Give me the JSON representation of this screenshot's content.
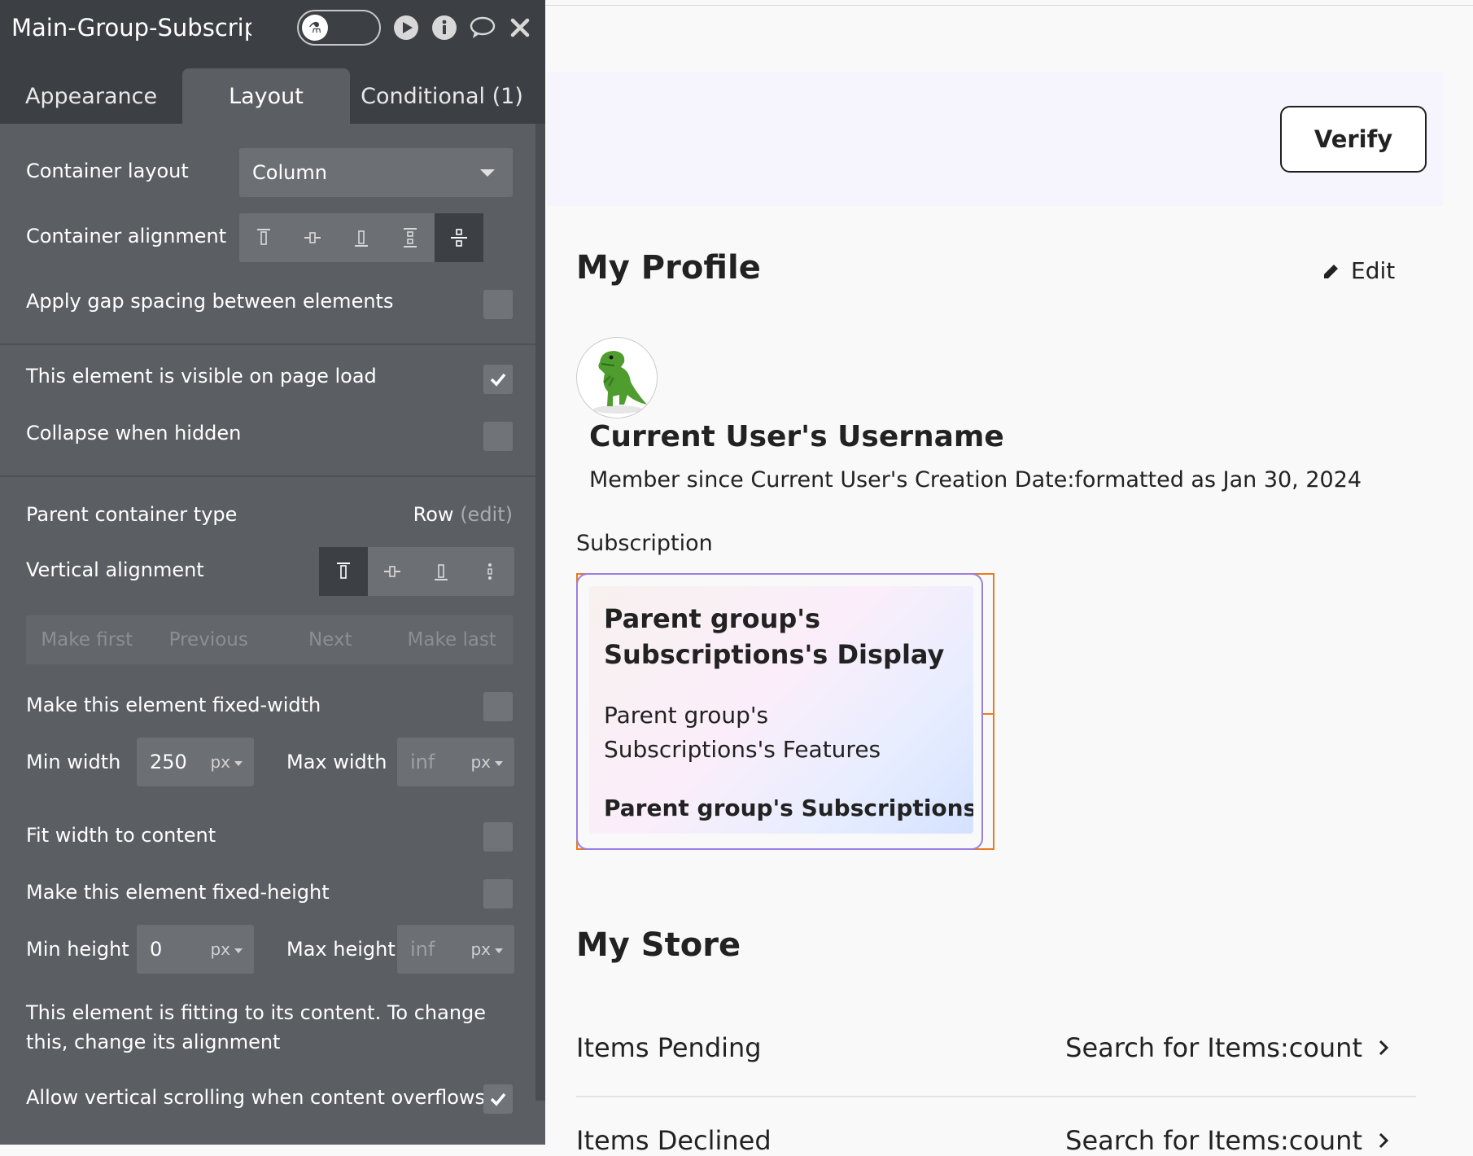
{
  "panel": {
    "title": "Main-Group-Subscription",
    "tabs": [
      "Appearance",
      "Layout",
      "Conditional (1)"
    ],
    "container_layout": {
      "label": "Container layout",
      "value": "Column"
    },
    "container_alignment": {
      "label": "Container alignment"
    },
    "gap_spacing": {
      "label": "Apply gap spacing between elements",
      "checked": false
    },
    "visible_on_load": {
      "label": "This element is visible on page load",
      "checked": true
    },
    "collapse_hidden": {
      "label": "Collapse when hidden",
      "checked": false
    },
    "parent_container": {
      "label": "Parent container type",
      "value": "Row",
      "edit": "(edit)"
    },
    "vertical_alignment": {
      "label": "Vertical alignment"
    },
    "order_buttons": [
      "Make first",
      "Previous",
      "Next",
      "Make last"
    ],
    "fixed_width": {
      "label": "Make this element fixed-width",
      "checked": false
    },
    "min_width": {
      "label": "Min width",
      "value": "250",
      "unit": "px"
    },
    "max_width": {
      "label": "Max width",
      "value": "inf",
      "unit": "px"
    },
    "fit_width": {
      "label": "Fit width to content",
      "checked": false
    },
    "fixed_height": {
      "label": "Make this element fixed-height",
      "checked": false
    },
    "min_height": {
      "label": "Min height",
      "value": "0",
      "unit": "px"
    },
    "max_height": {
      "label": "Max height",
      "value": "inf",
      "unit": "px"
    },
    "fitting_note": "This element is fitting to its content. To change this, change its alignment",
    "vertical_scroll": {
      "label": "Allow vertical scrolling when content overflows",
      "checked": true
    }
  },
  "canvas": {
    "verify_label": "Verify",
    "profile_title": "My Profile",
    "edit_label": "Edit",
    "username": "Current User's Username",
    "member_since": "Member since Current User's Creation Date:formatted as Jan 30, 2024",
    "subscription_label": "Subscription",
    "card": {
      "title": "Parent group's Subscriptions's Display",
      "features": "Parent group's Subscriptions's Features",
      "price": "Parent group's Subscriptions's Price"
    },
    "store_title": "My Store",
    "store_rows": [
      {
        "label": "Items Pending",
        "value": "Search for Items:count"
      },
      {
        "label": "Items Declined",
        "value": "Search for Items:count"
      }
    ]
  },
  "colors": {
    "panel_bg": "#5b5f63",
    "panel_header": "#3c4044",
    "selection_orange": "#e97b1f",
    "selection_purple": "#9b7fe0"
  }
}
